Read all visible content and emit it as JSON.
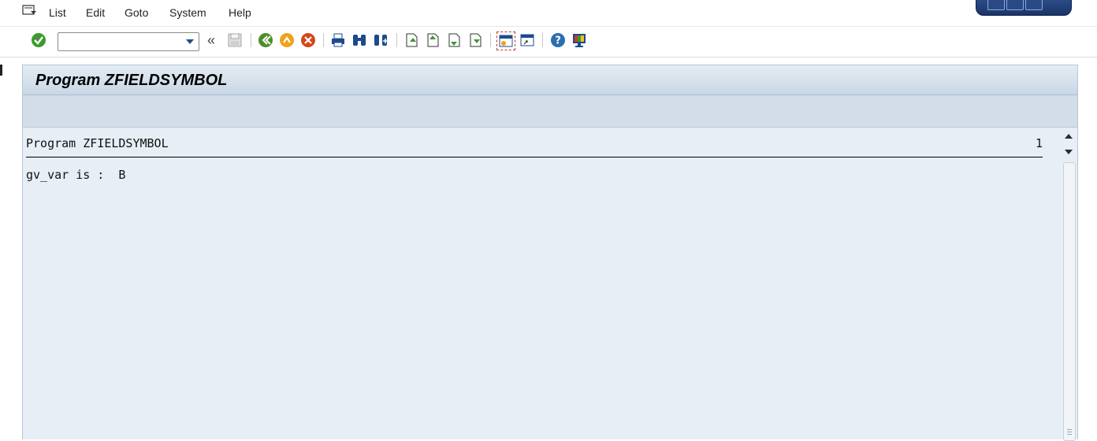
{
  "menu": {
    "items": [
      {
        "label": "List"
      },
      {
        "label": "Edit"
      },
      {
        "label": "Goto"
      },
      {
        "label": "System"
      },
      {
        "label": "Help"
      }
    ]
  },
  "toolbar": {
    "command_field": {
      "value": "",
      "placeholder": ""
    },
    "back_double_label": "«",
    "buttons": [
      "enter-icon",
      "save-icon",
      "back-icon",
      "exit-icon",
      "cancel-icon",
      "print-icon",
      "find-icon",
      "find-next-icon",
      "first-page-icon",
      "previous-page-icon",
      "next-page-icon",
      "last-page-icon",
      "create-session-icon",
      "create-shortcut-icon",
      "help-icon",
      "customize-layout-icon"
    ]
  },
  "screen": {
    "title": "Program ZFIELDSYMBOL"
  },
  "list": {
    "header_title": "Program ZFIELDSYMBOL",
    "page_number": "1",
    "lines": [
      "gv_var is :  B"
    ]
  },
  "colors": {
    "accent": "#1c4b8c",
    "panel_bg": "#e8eef5",
    "title_bg": "#c9d7e5"
  }
}
